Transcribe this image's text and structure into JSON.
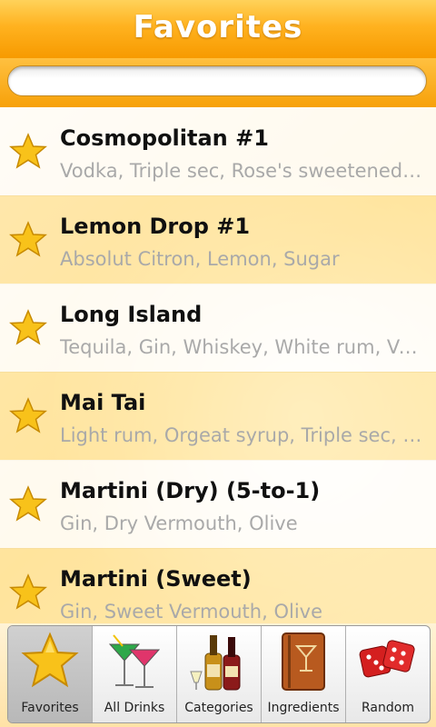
{
  "app": {
    "title": "Favorites",
    "search": {
      "placeholder": "",
      "value": ""
    }
  },
  "favorites": [
    {
      "name": "Cosmopolitan #1",
      "ingredients": "Vodka, Triple sec, Rose's sweetened lime juice, Cranberry juice"
    },
    {
      "name": "Lemon Drop #1",
      "ingredients": "Absolut Citron, Lemon, Sugar"
    },
    {
      "name": "Long Island",
      "ingredients": "Tequila, Gin, Whiskey, White rum, Vodka, Triple sec"
    },
    {
      "name": "Mai Tai",
      "ingredients": "Light rum, Orgeat syrup, Triple sec, Sweet and sour"
    },
    {
      "name": "Martini (Dry) (5-to-1)",
      "ingredients": "Gin, Dry Vermouth, Olive"
    },
    {
      "name": "Martini (Sweet)",
      "ingredients": "Gin, Sweet Vermouth, Olive"
    }
  ],
  "tabs": [
    {
      "label": "Favorites",
      "icon": "star-icon",
      "active": true
    },
    {
      "label": "All Drinks",
      "icon": "cocktail-glasses-icon",
      "active": false
    },
    {
      "label": "Categories",
      "icon": "bottles-icon",
      "active": false
    },
    {
      "label": "Ingredients",
      "icon": "recipe-book-icon",
      "active": false
    },
    {
      "label": "Random",
      "icon": "dice-icon",
      "active": false
    }
  ],
  "colors": {
    "title_bar": "#f7a10a",
    "star": "#f8c21a",
    "ingredient_text": "#a9a9a9"
  }
}
